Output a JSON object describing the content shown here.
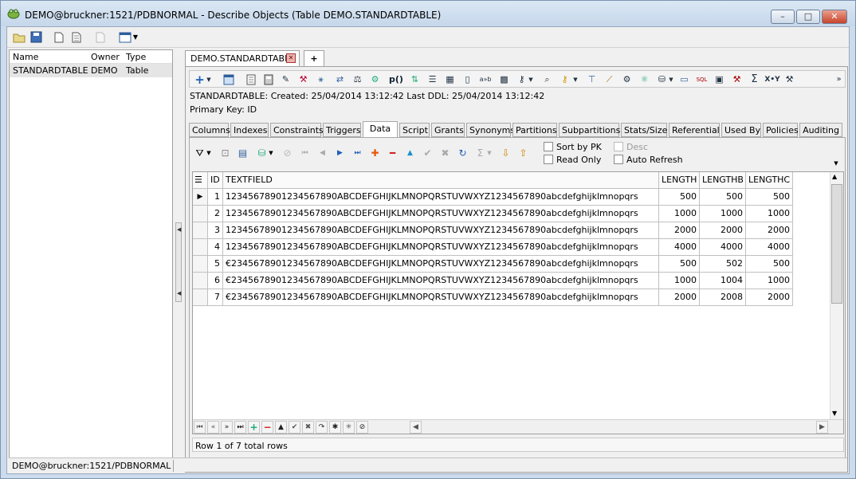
{
  "window": {
    "title": "DEMO@bruckner:1521/PDBNORMAL - Describe Objects (Table DEMO.STANDARDTABLE)",
    "min": "–",
    "max": "□",
    "close": "✕"
  },
  "left_pane": {
    "columns": [
      "Name",
      "Owner",
      "Type"
    ],
    "rows": [
      {
        "name": "STANDARDTABLE",
        "owner": "DEMO",
        "type": "Table"
      }
    ]
  },
  "doc_tabs": {
    "active": "DEMO.STANDARDTABLE",
    "close": "✕",
    "add": "+"
  },
  "info": {
    "line1": "STANDARDTABLE:  Created: 25/04/2014 13:12:42   Last DDL: 25/04/2014 13:12:42",
    "line2": "Primary Key:  ID"
  },
  "tabs": [
    "Columns",
    "Indexes",
    "Constraints",
    "Triggers",
    "Data",
    "Script",
    "Grants",
    "Synonyms",
    "Partitions",
    "Subpartitions",
    "Stats/Size",
    "Referential",
    "Used By",
    "Policies",
    "Auditing"
  ],
  "active_tab": "Data",
  "data_toolbar": {
    "sort_by_pk": "Sort by PK",
    "desc": "Desc",
    "read_only": "Read Only",
    "auto_refresh": "Auto Refresh"
  },
  "grid": {
    "headers": [
      "ID",
      "TEXTFIELD",
      "LENGTH",
      "LENGTHB",
      "LENGTHC"
    ],
    "rows": [
      [
        "1",
        "1234567890123456789 0ABCDEFGHIJKLMNOPQRSTUVWXYZ1234567890abcdefghijklmnopqrs",
        "500",
        "500",
        "500"
      ],
      [
        "2",
        "12345678901234567890ABCDEFGHIJKLMNOPQRSTUVWXYZ1234567890abcdefghijklmnopqrs",
        "1000",
        "1000",
        "1000"
      ],
      [
        "3",
        "12345678901234567890ABCDEFGHIJKLMNOPQRSTUVWXYZ1234567890abcdefghijklmnopqrs",
        "2000",
        "2000",
        "2000"
      ],
      [
        "4",
        "12345678901234567890ABCDEFGHIJKLMNOPQRSTUVWXYZ1234567890abcdefghijklmnopqrs",
        "4000",
        "4000",
        "4000"
      ],
      [
        "5",
        "€2345678901234567890ABCDEFGHIJKLMNOPQRSTUVWXYZ1234567890abcdefghijklmnopqrs",
        "500",
        "502",
        "500"
      ],
      [
        "6",
        "€2345678901234567890ABCDEFGHIJKLMNOPQRSTUVWXYZ1234567890abcdefghijklmnopqrs",
        "1000",
        "1004",
        "1000"
      ],
      [
        "7",
        "€2345678901234567890ABCDEFGHIJKLMNOPQRSTUVWXYZ1234567890abcdefghijklmnopqrs",
        "2000",
        "2008",
        "2000"
      ]
    ]
  },
  "row_status": "Row 1 of 7 total rows",
  "status_bar": "DEMO@bruckner:1521/PDBNORMAL"
}
